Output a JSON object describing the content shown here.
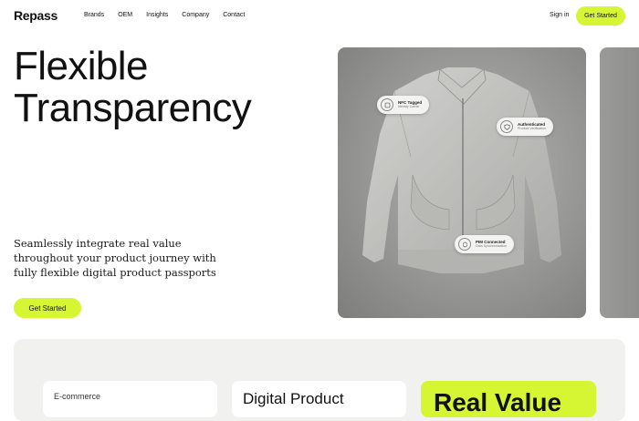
{
  "nav": {
    "logo": "Repass",
    "links": [
      "Brands",
      "OEM",
      "Insights",
      "Company",
      "Contact"
    ],
    "sign_in": "Sign in",
    "cta": "Get Started"
  },
  "hero": {
    "title_line1": "Flexible",
    "title_line2": "Transparency",
    "subtitle": "Seamlessly integrate real value throughout your product journey with fully flexible digital product passports",
    "cta": "Get Started"
  },
  "image_card": {
    "chips": [
      {
        "title": "NFC Tagged",
        "sub": "Identity Carrier",
        "icon": "nfc-icon"
      },
      {
        "title": "Authenticated",
        "sub": "Product Verification",
        "icon": "shield-check-icon"
      },
      {
        "title": "PIM Connected",
        "sub": "Data Synchronization",
        "icon": "sync-icon"
      }
    ]
  },
  "features": {
    "card1_label": "E-commerce",
    "card2_title": "Digital Product",
    "card3_title": "Real Value"
  },
  "colors": {
    "accent": "#d6f533",
    "background": "#ffffff",
    "section_bg": "#f1f1ef"
  }
}
